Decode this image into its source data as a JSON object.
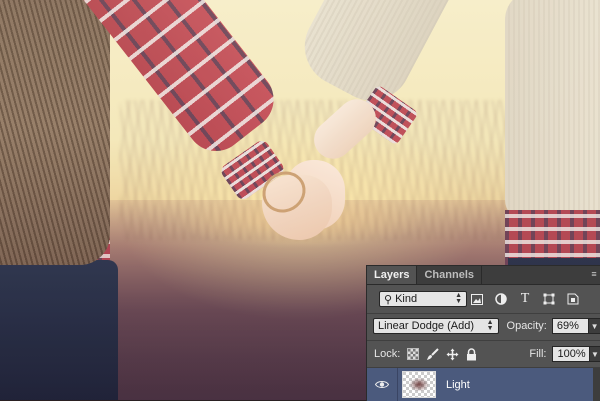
{
  "layers_panel": {
    "tabs": [
      {
        "label": "Layers",
        "active": true
      },
      {
        "label": "Channels",
        "active": false
      }
    ],
    "panel_menu_icon": "panel-menu-icon",
    "filter": {
      "kind_value": "Kind",
      "filter_icons": [
        "pixel-layer-filter-icon",
        "adjustment-layer-filter-icon",
        "type-layer-filter-icon",
        "shape-layer-filter-icon",
        "smart-object-filter-icon"
      ]
    },
    "blend_mode": "Linear Dodge (Add)",
    "opacity_label": "Opacity:",
    "opacity_value": "69%",
    "lock_label": "Lock:",
    "lock_icons": [
      "lock-transparency-icon",
      "lock-pixels-icon",
      "lock-position-icon",
      "lock-all-icon"
    ],
    "fill_label": "Fill:",
    "fill_value": "100%",
    "layers": [
      {
        "name": "Light",
        "visible": true,
        "selected": true
      }
    ]
  },
  "colors": {
    "panel_bg": "#535353",
    "tab_bar": "#3d3d3d",
    "selected_layer": "#4b5a7d"
  }
}
